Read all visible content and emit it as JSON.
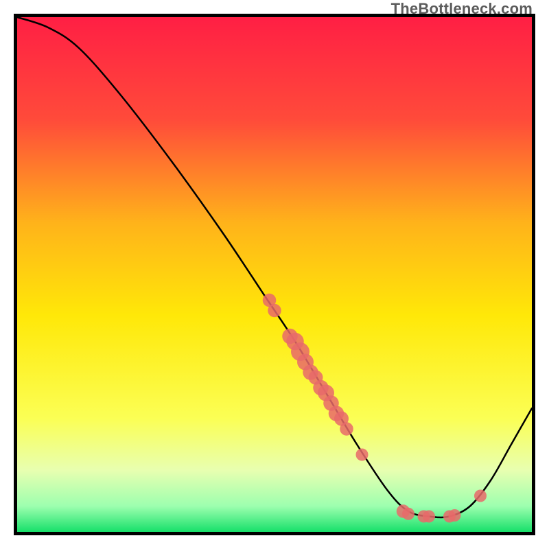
{
  "watermark": "TheBottleneck.com",
  "chart_data": {
    "type": "line",
    "title": "",
    "xlabel": "",
    "ylabel": "",
    "xlim": [
      0,
      100
    ],
    "ylim": [
      0,
      100
    ],
    "gradient_stops": [
      {
        "offset": 0.0,
        "color": "#ff1f44"
      },
      {
        "offset": 0.2,
        "color": "#ff4b3a"
      },
      {
        "offset": 0.4,
        "color": "#ffb31a"
      },
      {
        "offset": 0.58,
        "color": "#ffe808"
      },
      {
        "offset": 0.78,
        "color": "#fbff55"
      },
      {
        "offset": 0.88,
        "color": "#e8ffb0"
      },
      {
        "offset": 0.95,
        "color": "#9dffaf"
      },
      {
        "offset": 1.0,
        "color": "#17e06a"
      }
    ],
    "curve_points": [
      {
        "x": 0,
        "y": 100
      },
      {
        "x": 6,
        "y": 98
      },
      {
        "x": 12,
        "y": 94
      },
      {
        "x": 20,
        "y": 85
      },
      {
        "x": 30,
        "y": 72
      },
      {
        "x": 40,
        "y": 58
      },
      {
        "x": 48,
        "y": 46
      },
      {
        "x": 54,
        "y": 37
      },
      {
        "x": 60,
        "y": 27
      },
      {
        "x": 66,
        "y": 17
      },
      {
        "x": 72,
        "y": 8
      },
      {
        "x": 76,
        "y": 4
      },
      {
        "x": 80,
        "y": 3
      },
      {
        "x": 84,
        "y": 3
      },
      {
        "x": 88,
        "y": 5
      },
      {
        "x": 92,
        "y": 10
      },
      {
        "x": 96,
        "y": 17
      },
      {
        "x": 100,
        "y": 24
      }
    ],
    "markers": [
      {
        "x": 49,
        "y": 45,
        "r": 1.3
      },
      {
        "x": 50,
        "y": 43,
        "r": 1.3
      },
      {
        "x": 53,
        "y": 38,
        "r": 1.5
      },
      {
        "x": 54,
        "y": 37,
        "r": 1.7
      },
      {
        "x": 55,
        "y": 35,
        "r": 1.8
      },
      {
        "x": 56,
        "y": 33,
        "r": 1.6
      },
      {
        "x": 57,
        "y": 31,
        "r": 1.5
      },
      {
        "x": 58,
        "y": 30,
        "r": 1.4
      },
      {
        "x": 59,
        "y": 28,
        "r": 1.5
      },
      {
        "x": 60,
        "y": 27,
        "r": 1.6
      },
      {
        "x": 61,
        "y": 25,
        "r": 1.5
      },
      {
        "x": 62,
        "y": 23,
        "r": 1.5
      },
      {
        "x": 63,
        "y": 22,
        "r": 1.4
      },
      {
        "x": 64,
        "y": 20,
        "r": 1.3
      },
      {
        "x": 67,
        "y": 15,
        "r": 1.2
      },
      {
        "x": 75,
        "y": 4,
        "r": 1.3
      },
      {
        "x": 76,
        "y": 3.5,
        "r": 1.2
      },
      {
        "x": 79,
        "y": 3,
        "r": 1.2
      },
      {
        "x": 80,
        "y": 3,
        "r": 1.2
      },
      {
        "x": 84,
        "y": 3,
        "r": 1.2
      },
      {
        "x": 85,
        "y": 3.2,
        "r": 1.2
      },
      {
        "x": 90,
        "y": 7,
        "r": 1.2
      }
    ],
    "marker_color": "#e86a6a",
    "curve_color": "#000000",
    "curve_width": 2.5
  }
}
